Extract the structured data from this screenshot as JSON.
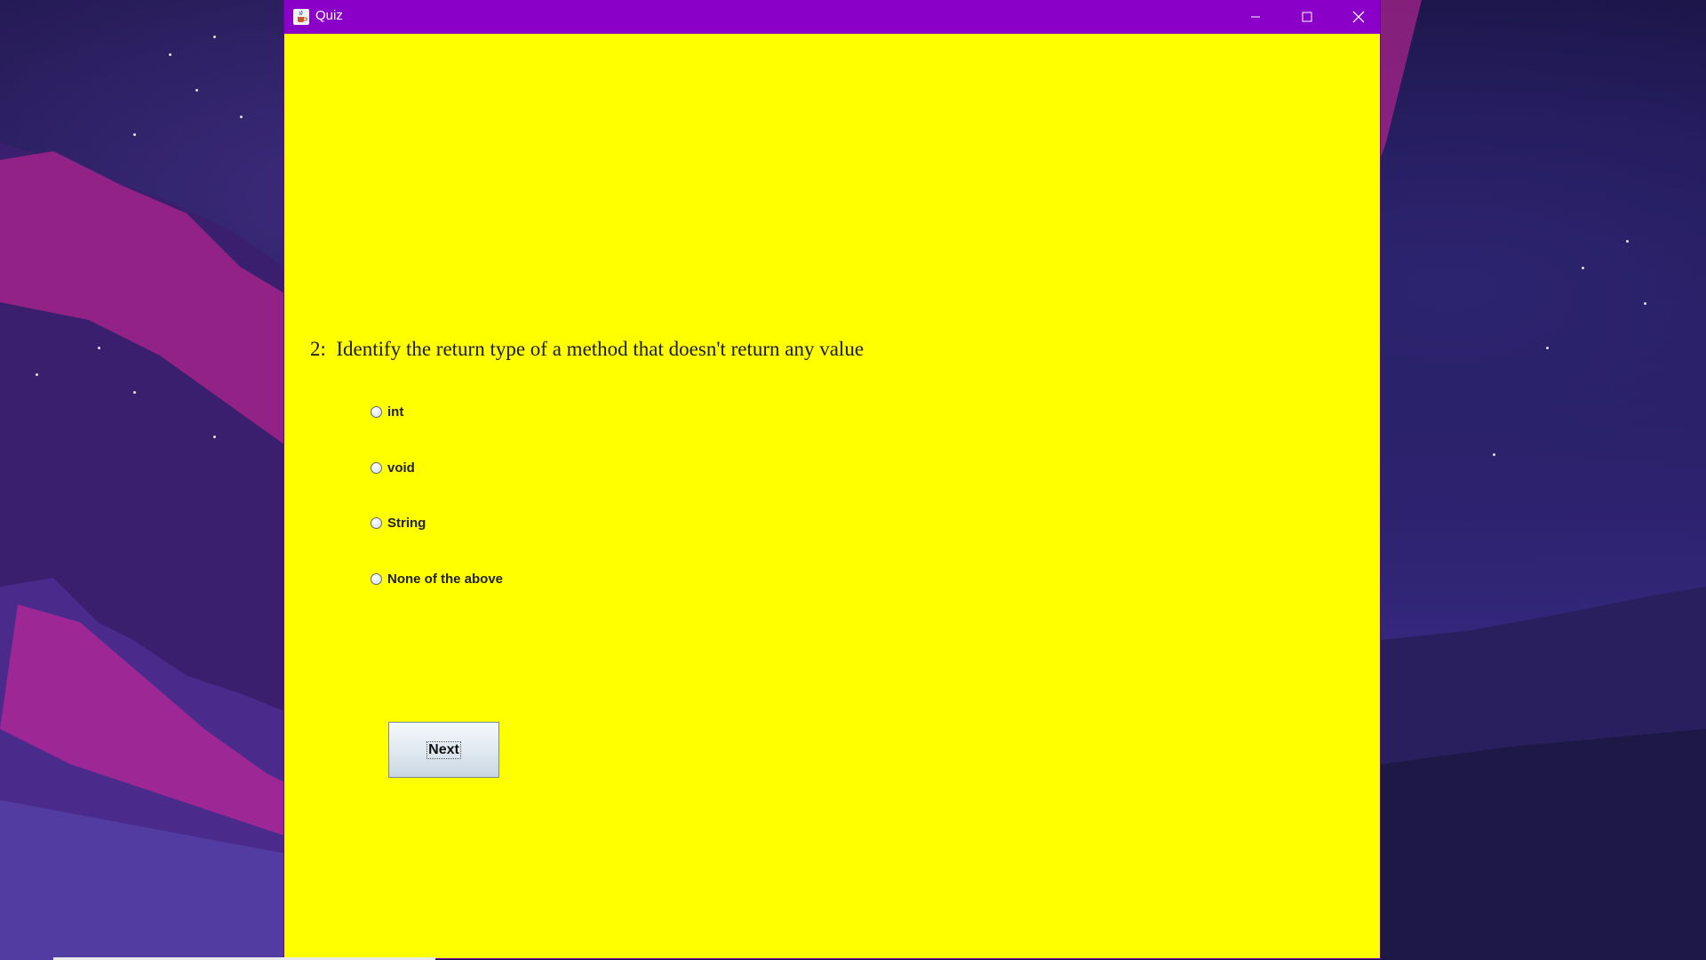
{
  "window": {
    "title": "Quiz",
    "app_icon": "java-cup-icon",
    "controls": [
      "minimize-icon",
      "maximize-icon",
      "close-icon"
    ],
    "background_color": "#ffff00",
    "titlebar_color": "#8a00c8"
  },
  "quiz": {
    "question_number": "2:",
    "question_text": "Identify the return type of a method that doesn't return any value",
    "options": [
      {
        "label": "int",
        "selected": false
      },
      {
        "label": "void",
        "selected": false
      },
      {
        "label": "String",
        "selected": false
      },
      {
        "label": "None of the above",
        "selected": false
      }
    ],
    "next_label": "Next"
  }
}
